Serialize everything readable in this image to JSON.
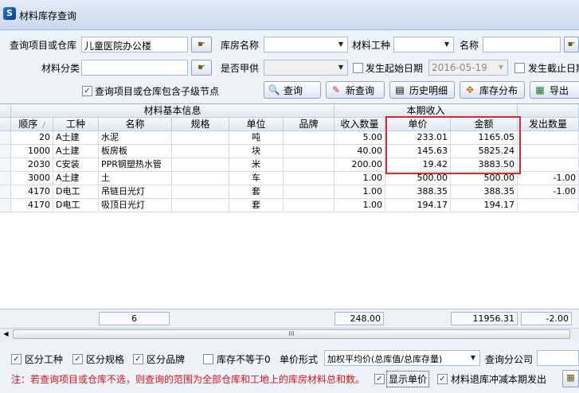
{
  "window": {
    "title": "材料库存查询",
    "icon_glyph": "S"
  },
  "form": {
    "project_label": "查询项目或仓库",
    "project_value": "儿童医院办公楼",
    "warehouse_label": "库房名称",
    "warehouse_value": "",
    "material_type_label": "材料工种",
    "material_type_value": "",
    "name_label": "名称",
    "name_value": "",
    "category_label": "材料分类",
    "category_value": "",
    "owner_supply_label": "是否甲供",
    "owner_supply_value": "",
    "start_date_check_label": "发生起始日期",
    "start_date_value": "2016-05-19",
    "end_date_check_label": "发生截止日期",
    "include_children_label": "查询项目或仓库包含子级节点",
    "include_children_checked": true
  },
  "buttons": {
    "query": "查询",
    "new_query": "新查询",
    "history": "历史明细",
    "distribution": "库存分布",
    "export": "导出"
  },
  "grid": {
    "group_headers": {
      "basic_info": "材料基本信息",
      "period_in": "本期收入"
    },
    "columns": [
      "顺序",
      "工种",
      "名称",
      "规格",
      "单位",
      "品牌",
      "收入数量",
      "单价",
      "金额",
      "发出数量"
    ],
    "sort_indicator": "/",
    "rows": [
      {
        "seq": "20",
        "trade": "A土建",
        "name": "水泥",
        "spec": "",
        "unit": "吨",
        "brand": "",
        "in_qty": "5.00",
        "price": "233.01",
        "amount": "1165.05",
        "out_qty": ""
      },
      {
        "seq": "1000",
        "trade": "A土建",
        "name": "板房板",
        "spec": "",
        "unit": "块",
        "brand": "",
        "in_qty": "40.00",
        "price": "145.63",
        "amount": "5825.24",
        "out_qty": ""
      },
      {
        "seq": "2030",
        "trade": "C安装",
        "name": "PPR钢塑热水管",
        "spec": "",
        "unit": "米",
        "brand": "",
        "in_qty": "200.00",
        "price": "19.42",
        "amount": "3883.50",
        "out_qty": ""
      },
      {
        "seq": "3000",
        "trade": "A土建",
        "name": "土",
        "spec": "",
        "unit": "车",
        "brand": "",
        "in_qty": "1.00",
        "price": "500.00",
        "amount": "500.00",
        "out_qty": "-1.00"
      },
      {
        "seq": "4170",
        "trade": "D电工",
        "name": "吊链日光灯",
        "spec": "",
        "unit": "套",
        "brand": "",
        "in_qty": "1.00",
        "price": "388.35",
        "amount": "388.35",
        "out_qty": "-1.00"
      },
      {
        "seq": "4170",
        "trade": "D电工",
        "name": "吸顶日光灯",
        "spec": "",
        "unit": "套",
        "brand": "",
        "in_qty": "1.00",
        "price": "194.17",
        "amount": "194.17",
        "out_qty": ""
      }
    ],
    "footer": {
      "count": "6",
      "in_qty_total": "248.00",
      "amount_total": "11956.31",
      "out_qty_total": "-2.00"
    },
    "scroll_grip": "III"
  },
  "options": {
    "by_trade": "区分工种",
    "by_spec": "区分规格",
    "by_brand": "区分品牌",
    "stock_nonzero": "库存不等于0",
    "price_form_label": "单价形式",
    "price_form_value": "加权平均价(总库值/总库存量)",
    "query_branch_label": "查询分公司",
    "note": "注：若查询项目或仓库不选，则查询的范围为全部仓库和工地上的库房材料总和数。",
    "show_price": "显示单价",
    "return_offset": "材料退库冲减本期发出"
  },
  "colors": {
    "highlight": "#e0282a",
    "note_text": "#e01010"
  }
}
